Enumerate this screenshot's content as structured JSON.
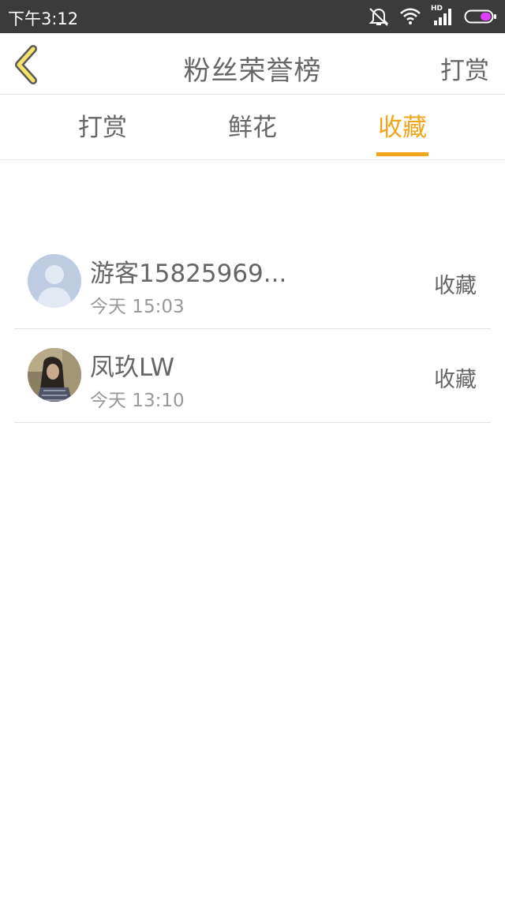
{
  "status_bar": {
    "time": "下午3:12",
    "icons": [
      "mute-icon",
      "wifi-icon",
      "signal-hd-icon",
      "battery-icon"
    ],
    "hd_label": "HD",
    "battery_color": "#e040fb"
  },
  "header": {
    "title": "粉丝荣誉榜",
    "action_label": "打赏",
    "back_icon": "chevron-left-icon",
    "back_icon_color": "#f5e36a"
  },
  "tabs": [
    {
      "label": "打赏",
      "active": false
    },
    {
      "label": "鲜花",
      "active": false
    },
    {
      "label": "收藏",
      "active": true
    }
  ],
  "colors": {
    "accent": "#f3a51a",
    "text_primary": "#666666",
    "text_secondary": "#999999",
    "status_bar_bg": "#3b3b3b"
  },
  "fans": [
    {
      "name": "游客15825969...",
      "time": "今天 15:03",
      "type": "收藏",
      "avatar": "default-avatar-icon"
    },
    {
      "name": "凤玖LW",
      "time": "今天 13:10",
      "type": "收藏",
      "avatar": "user-photo-avatar"
    }
  ]
}
